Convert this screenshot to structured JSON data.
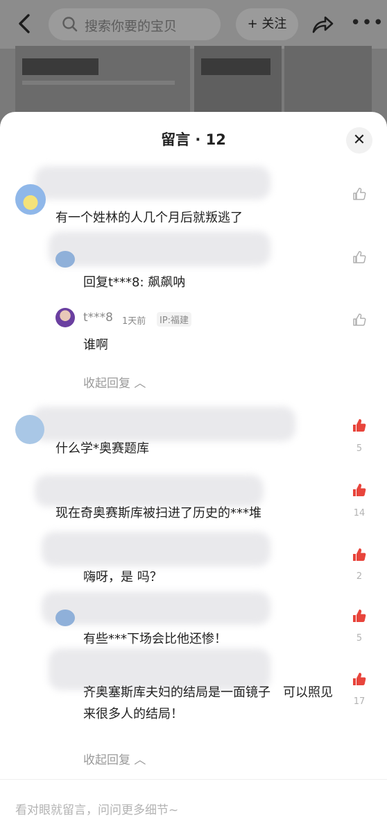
{
  "header": {
    "search_placeholder": "搜索你要的宝贝",
    "follow_label": "+ 关注"
  },
  "sheet": {
    "title": "留言 · 12",
    "input_placeholder": "看对眼就留言，问问更多细节~"
  },
  "comments": [
    {
      "text": "有一个姓林的人几个月后就叛逃了"
    },
    {
      "text": "回复t***8: 飙飙呐"
    },
    {
      "name": "t***8",
      "time": "1天前",
      "ip": "IP:福建",
      "text": "谁啊"
    },
    {
      "text": "什么学*奥赛题库",
      "likes": "5"
    },
    {
      "text": "现在奇奥赛斯库被扫进了历史的***堆",
      "likes": "14"
    },
    {
      "text": "嗨呀，是 吗？",
      "likes": "2"
    },
    {
      "text": "有些***下场会比他还惨！",
      "likes": "5"
    },
    {
      "text": "齐奥塞斯库夫妇的结局是一面镜子　可以照见来很多人的结局！",
      "likes": "17"
    }
  ],
  "folds": [
    "收起回复",
    "收起回复"
  ],
  "colors": {
    "liked": "#e8453c",
    "unliked": "#b0b0b0"
  }
}
